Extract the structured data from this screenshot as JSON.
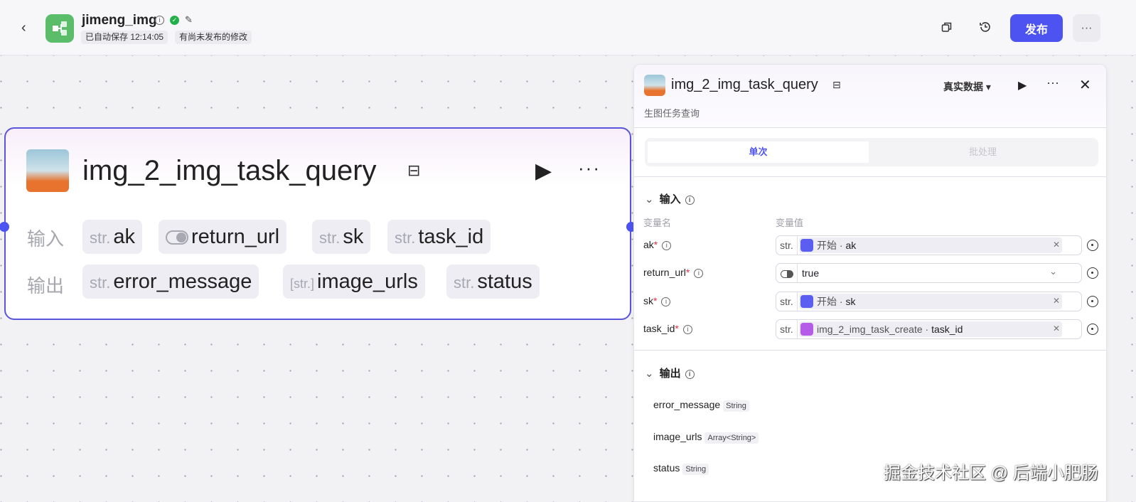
{
  "header": {
    "app_title": "jimeng_img",
    "autosave": "已自动保存 12:14:05",
    "unpublished": "有尚未发布的修改",
    "publish_label": "发布",
    "more_label": "···"
  },
  "node": {
    "title": "img_2_img_task_query",
    "input_label": "输入",
    "output_label": "输出",
    "inputs": [
      {
        "type": "str.",
        "name": "ak"
      },
      {
        "type": "toggle",
        "name": "return_url"
      },
      {
        "type": "str.",
        "name": "sk"
      },
      {
        "type": "str.",
        "name": "task_id"
      }
    ],
    "outputs": [
      {
        "type": "str.",
        "name": "error_message"
      },
      {
        "type": "[str.]",
        "name": "image_urls"
      },
      {
        "type": "str.",
        "name": "status"
      }
    ]
  },
  "panel": {
    "title": "img_2_img_task_query",
    "description": "生图任务查询",
    "data_mode": "真实数据",
    "tabs": [
      "单次",
      "批处理"
    ],
    "input_section": "输入",
    "col_name": "变量名",
    "col_value": "变量值",
    "inputs": [
      {
        "name": "ak",
        "type": "str.",
        "source": "开始",
        "sep": " · ",
        "field": "ak"
      },
      {
        "name": "return_url",
        "value": "true"
      },
      {
        "name": "sk",
        "type": "str.",
        "source": "开始",
        "sep": " · ",
        "field": "sk"
      },
      {
        "name": "task_id",
        "type": "str.",
        "source": "img_2_img_task_create",
        "sep": " · ",
        "field": "task_id"
      }
    ],
    "output_section": "输出",
    "outputs": [
      {
        "name": "error_message",
        "type": "String"
      },
      {
        "name": "image_urls",
        "type": "Array<String>"
      },
      {
        "name": "status",
        "type": "String"
      }
    ]
  },
  "watermark": "掘金技术社区 @ 后端小肥肠",
  "colors": {
    "accent": "#4d53f1",
    "logo": "#5bbd6a",
    "ref_start": "#5b5ef0",
    "ref_node": "#b45be8"
  }
}
